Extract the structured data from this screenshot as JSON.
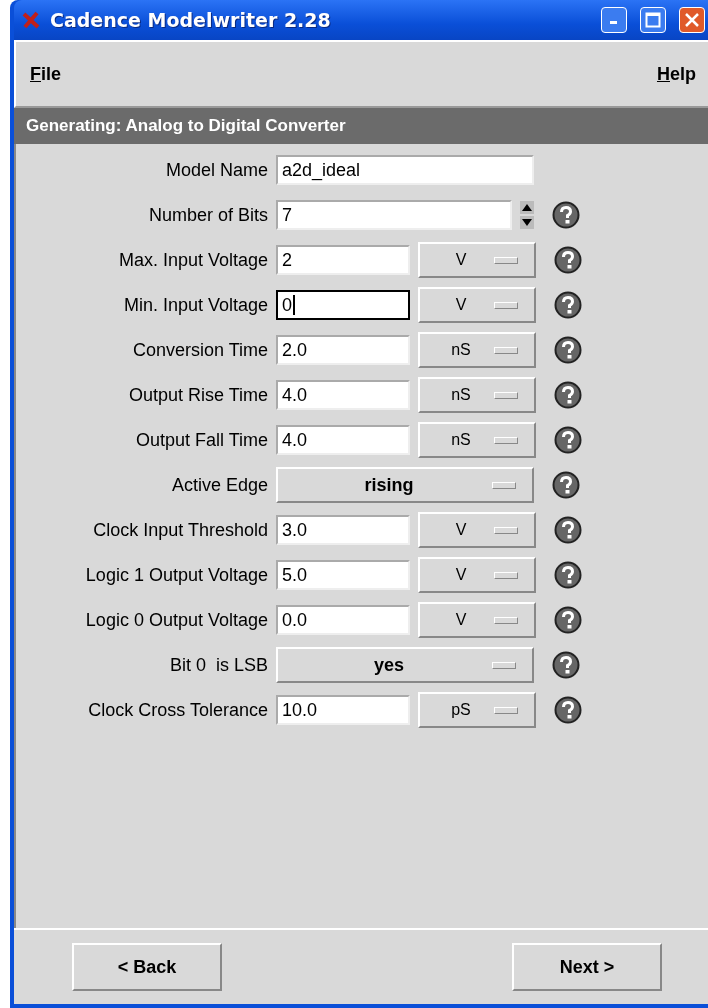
{
  "window": {
    "title": "Cadence Modelwriter 2.28"
  },
  "menu": [
    {
      "label": "File"
    },
    {
      "label": "Help"
    }
  ],
  "header": "Generating: Analog to Digital Converter",
  "fields": [
    {
      "kind": "text",
      "label": "Model Name",
      "value": "a2d_ideal",
      "focused": false,
      "help": false
    },
    {
      "kind": "spin",
      "label": "Number of Bits",
      "value": "7",
      "focused": false,
      "help": true
    },
    {
      "kind": "unit",
      "label": "Max. Input Voltage",
      "value": "2",
      "unit": "V",
      "focused": false,
      "help": true
    },
    {
      "kind": "unit",
      "label": "Min. Input Voltage",
      "value": "0",
      "unit": "V",
      "focused": true,
      "help": true
    },
    {
      "kind": "unit",
      "label": "Conversion Time",
      "value": "2.0",
      "unit": "nS",
      "focused": false,
      "help": true
    },
    {
      "kind": "unit",
      "label": "Output Rise Time",
      "value": "4.0",
      "unit": "nS",
      "focused": false,
      "help": true
    },
    {
      "kind": "unit",
      "label": "Output Fall Time",
      "value": "4.0",
      "unit": "nS",
      "focused": false,
      "help": true
    },
    {
      "kind": "select",
      "label": "Active Edge",
      "value": "rising",
      "help": true
    },
    {
      "kind": "unit",
      "label": "Clock Input Threshold",
      "value": "3.0",
      "unit": "V",
      "focused": false,
      "help": true
    },
    {
      "kind": "unit",
      "label": "Logic 1 Output Voltage",
      "value": "5.0",
      "unit": "V",
      "focused": false,
      "help": true
    },
    {
      "kind": "unit",
      "label": "Logic 0 Output Voltage",
      "value": "0.0",
      "unit": "V",
      "focused": false,
      "help": true
    },
    {
      "kind": "select",
      "label": "Bit 0  is LSB",
      "value": "yes",
      "help": true
    },
    {
      "kind": "unit",
      "label": "Clock Cross Tolerance",
      "value": "10.0",
      "unit": "pS",
      "focused": false,
      "help": true
    }
  ],
  "buttons": [
    {
      "label": "< Back"
    },
    {
      "label": "Next >"
    }
  ]
}
